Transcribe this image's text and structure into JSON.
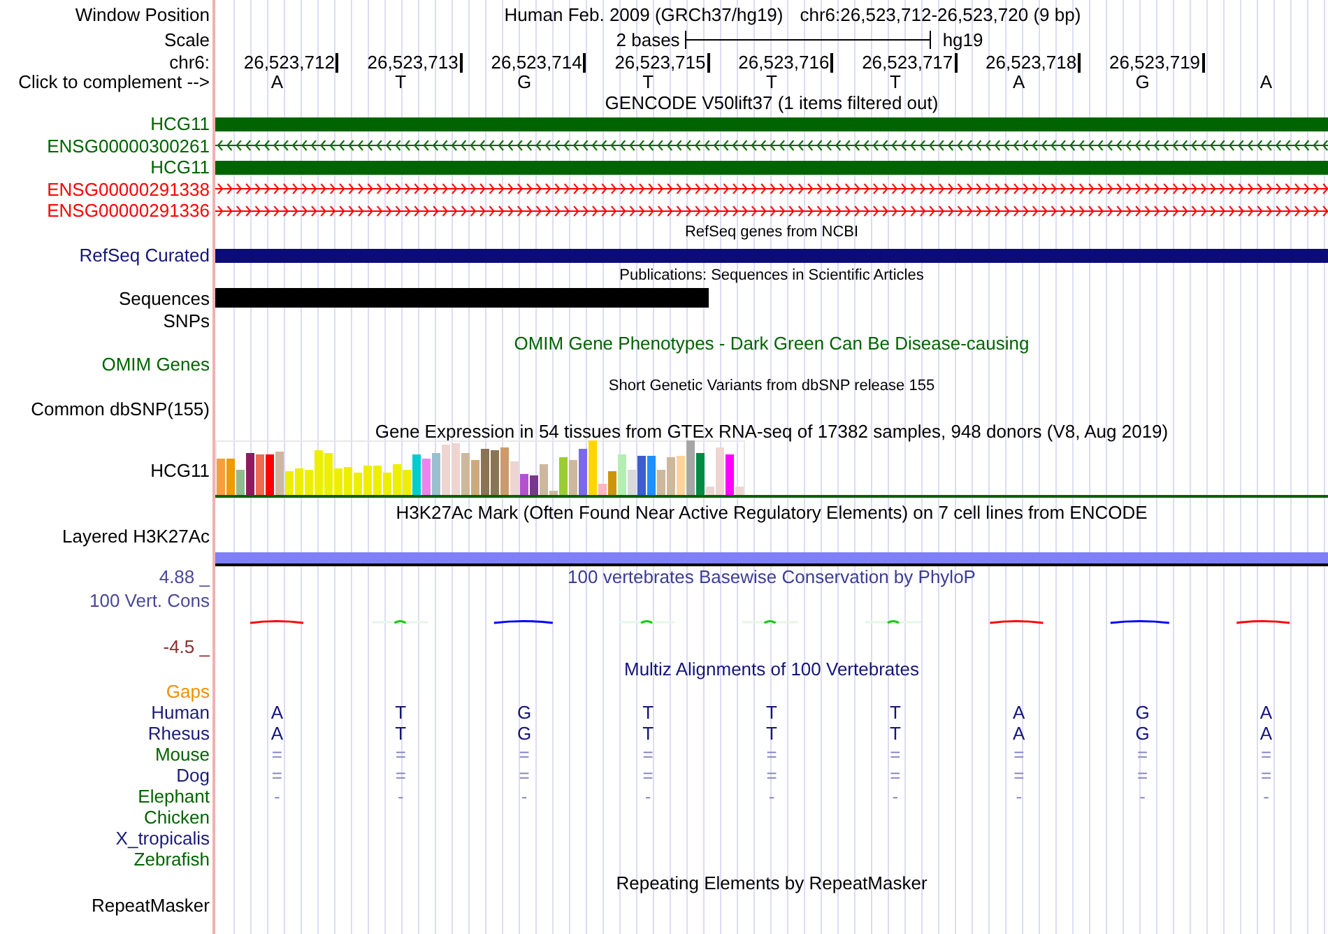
{
  "header": {
    "label": "Window Position",
    "assembly": "Human Feb. 2009 (GRCh37/hg19)",
    "position": "chr6:26,523,712-26,523,720 (9 bp)"
  },
  "scale": {
    "label": "Scale",
    "length": "2 bases",
    "assembly": "hg19"
  },
  "ruler": {
    "label": "chr6:",
    "ticks": [
      "26,523,712",
      "26,523,713",
      "26,523,714",
      "26,523,715",
      "26,523,716",
      "26,523,717",
      "26,523,718",
      "26,523,719"
    ]
  },
  "bases": {
    "label": "Click to complement -->",
    "values": [
      "A",
      "T",
      "G",
      "T",
      "T",
      "T",
      "A",
      "G",
      "A"
    ]
  },
  "gencode": {
    "title": "GENCODE V50lift37 (1 items filtered out)",
    "genes": [
      {
        "name": "HCG11",
        "color": "#006400",
        "kind": "block"
      },
      {
        "name": "ENSG00000300261",
        "color": "#006400",
        "kind": "leftarrows"
      },
      {
        "name": "HCG11",
        "color": "#006400",
        "kind": "block"
      },
      {
        "name": "ENSG00000291338",
        "color": "#ff0000",
        "kind": "rightarrows"
      },
      {
        "name": "ENSG00000291336",
        "color": "#ff0000",
        "kind": "rightarrows"
      }
    ]
  },
  "refseq": {
    "title": "RefSeq genes from NCBI",
    "label": "RefSeq Curated"
  },
  "publications": {
    "title": "Publications: Sequences in Scientific Articles",
    "label": "Sequences"
  },
  "snps": {
    "label": "SNPs"
  },
  "omim": {
    "title": "OMIM Gene Phenotypes - Dark Green Can Be Disease-causing",
    "label": "OMIM Genes"
  },
  "dbsnp": {
    "title": "Short Genetic Variants from dbSNP release 155",
    "label": "Common dbSNP(155)"
  },
  "gtex": {
    "title": "Gene Expression in 54 tissues from GTEx RNA-seq of 17382 samples, 948 donors (V8, Aug 2019)",
    "label": "HCG11"
  },
  "h3k27ac": {
    "title": "H3K27Ac Mark (Often Found Near Active Regulatory Elements) on 7 cell lines from ENCODE",
    "label": "Layered H3K27Ac"
  },
  "conservation": {
    "title": "100 vertebrates Basewise Conservation by PhyloP",
    "label": "100 Vert. Cons",
    "max": "4.88 _",
    "min": "-4.5 _"
  },
  "multiz": {
    "title": "Multiz Alignments of 100 Vertebrates",
    "gaps_label": "Gaps",
    "species": [
      {
        "name": "Human",
        "color": "#1a1a78",
        "kind": "bases",
        "cells": [
          "A",
          "T",
          "G",
          "T",
          "T",
          "T",
          "A",
          "G",
          "A"
        ]
      },
      {
        "name": "Rhesus",
        "color": "#1a1a78",
        "kind": "bases",
        "cells": [
          "A",
          "T",
          "G",
          "T",
          "T",
          "T",
          "A",
          "G",
          "A"
        ]
      },
      {
        "name": "Mouse",
        "color": "#006400",
        "kind": "gap",
        "cells": [
          "=",
          "=",
          "=",
          "=",
          "=",
          "=",
          "=",
          "=",
          "="
        ]
      },
      {
        "name": "Dog",
        "color": "#1a1a78",
        "kind": "gap",
        "cells": [
          "=",
          "=",
          "=",
          "=",
          "=",
          "=",
          "=",
          "=",
          "="
        ]
      },
      {
        "name": "Elephant",
        "color": "#006400",
        "kind": "gap",
        "cells": [
          "-",
          "-",
          "-",
          "-",
          "-",
          "-",
          "-",
          "-",
          "-"
        ]
      },
      {
        "name": "Chicken",
        "color": "#006400",
        "kind": "none"
      },
      {
        "name": "X_tropicalis",
        "color": "#1a1a78",
        "kind": "none"
      },
      {
        "name": "Zebrafish",
        "color": "#006400",
        "kind": "none"
      }
    ]
  },
  "repeatmasker": {
    "title": "Repeating Elements by RepeatMasker",
    "label": "RepeatMasker"
  }
}
